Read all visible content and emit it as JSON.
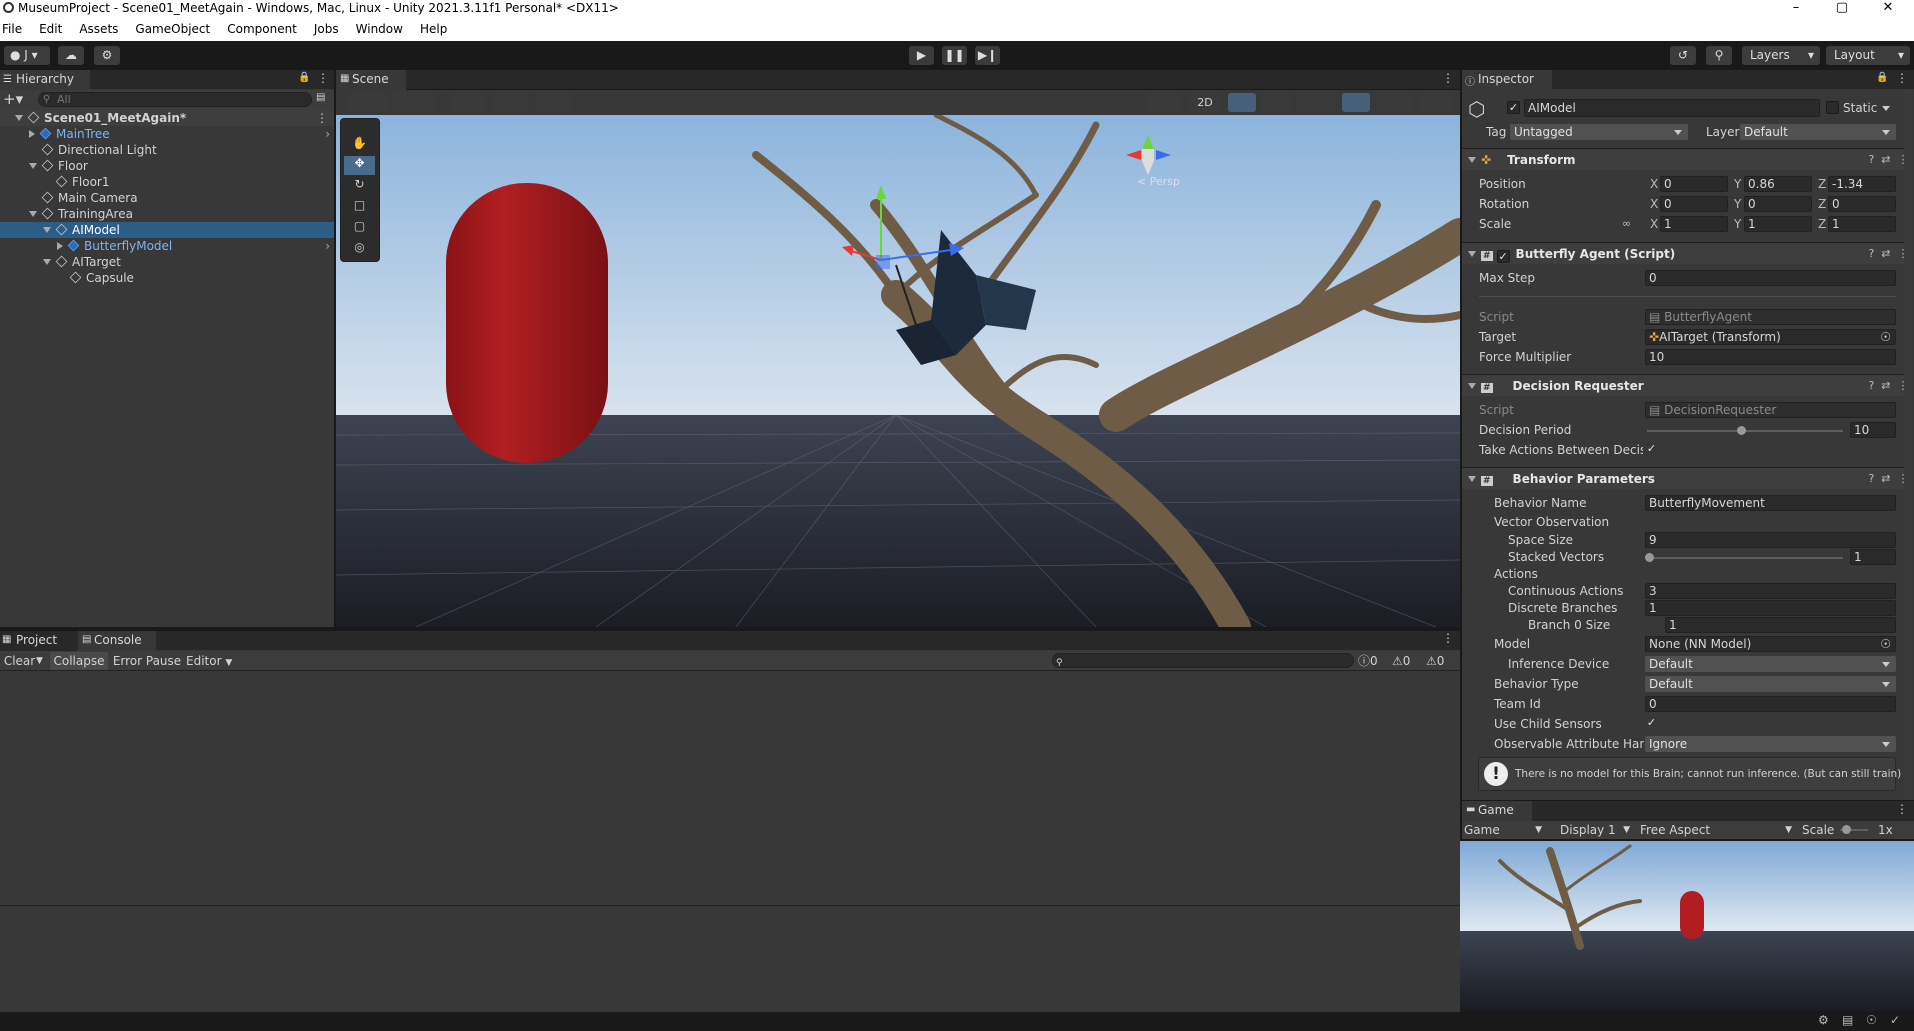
{
  "window": {
    "title": "MuseumProject - Scene01_MeetAgain - Windows, Mac, Linux - Unity 2021.3.11f1 Personal* <DX11>"
  },
  "menu": [
    "File",
    "Edit",
    "Assets",
    "GameObject",
    "Component",
    "Jobs",
    "Window",
    "Help"
  ],
  "toolbar": {
    "account": "J",
    "layers": "Layers",
    "layout": "Layout"
  },
  "hierarchy": {
    "tab": "Hierarchy",
    "search_placeholder": "All",
    "items": [
      {
        "label": "Scene01_MeetAgain*",
        "depth": 0,
        "kind": "scene"
      },
      {
        "label": "MainTree",
        "depth": 1,
        "kind": "prefab"
      },
      {
        "label": "Directional Light",
        "depth": 1,
        "kind": "obj"
      },
      {
        "label": "Floor",
        "depth": 1,
        "kind": "obj"
      },
      {
        "label": "Floor1",
        "depth": 2,
        "kind": "obj"
      },
      {
        "label": "Main Camera",
        "depth": 1,
        "kind": "obj"
      },
      {
        "label": "TrainingArea",
        "depth": 1,
        "kind": "obj"
      },
      {
        "label": "AIModel",
        "depth": 2,
        "kind": "obj",
        "selected": true
      },
      {
        "label": "ButterflyModel",
        "depth": 3,
        "kind": "prefab"
      },
      {
        "label": "AITarget",
        "depth": 2,
        "kind": "obj"
      },
      {
        "label": "Capsule",
        "depth": 3,
        "kind": "obj"
      }
    ]
  },
  "scene": {
    "tab": "Scene",
    "btn_2d": "2D",
    "persp": "< Persp"
  },
  "console": {
    "tabs": [
      "Project",
      "Console"
    ],
    "clear": "Clear",
    "collapse": "Collapse",
    "error_pause": "Error Pause",
    "editor": "Editor",
    "counts": [
      "0",
      "0",
      "0"
    ]
  },
  "inspector": {
    "tab": "Inspector",
    "object_name": "AIModel",
    "static": "Static",
    "tag_label": "Tag",
    "tag": "Untagged",
    "layer_label": "Layer",
    "layer": "Default",
    "transform": {
      "title": "Transform",
      "position_label": "Position",
      "rotation_label": "Rotation",
      "scale_label": "Scale",
      "position": {
        "x": "0",
        "y": "0.86",
        "z": "-1.34"
      },
      "rotation": {
        "x": "0",
        "y": "0",
        "z": "0"
      },
      "scale": {
        "x": "1",
        "y": "1",
        "z": "1"
      }
    },
    "agent": {
      "title": "Butterfly Agent (Script)",
      "max_step_label": "Max Step",
      "max_step": "0",
      "script_label": "Script",
      "script": "ButterflyAgent",
      "target_label": "Target",
      "target": "AITarget (Transform)",
      "force_label": "Force Multiplier",
      "force": "10"
    },
    "decision": {
      "title": "Decision Requester",
      "script_label": "Script",
      "script": "DecisionRequester",
      "period_label": "Decision Period",
      "period": "10",
      "period_fraction": 0.48,
      "take_actions_label": "Take Actions Between Decisi"
    },
    "behavior": {
      "title": "Behavior Parameters",
      "name_label": "Behavior Name",
      "name": "ButterflyMovement",
      "vector_obs": "Vector Observation",
      "space_size_label": "Space Size",
      "space_size": "9",
      "stacked_label": "Stacked Vectors",
      "stacked": "1",
      "actions": "Actions",
      "cont_label": "Continuous Actions",
      "cont": "3",
      "disc_label": "Discrete Branches",
      "disc": "1",
      "branch0_label": "Branch 0 Size",
      "branch0": "1",
      "model_label": "Model",
      "model": "None (NN Model)",
      "device_label": "Inference Device",
      "device": "Default",
      "type_label": "Behavior Type",
      "type": "Default",
      "team_label": "Team Id",
      "team": "0",
      "child_label": "Use Child Sensors",
      "obs_label": "Observable Attribute Hand",
      "obs": "Ignore"
    },
    "warning": "There is no model for this Brain; cannot run inference. (But can still train)"
  },
  "game": {
    "tab": "Game",
    "mode": "Game",
    "display": "Display 1",
    "aspect": "Free Aspect",
    "scale_label": "Scale",
    "scale": "1x"
  }
}
